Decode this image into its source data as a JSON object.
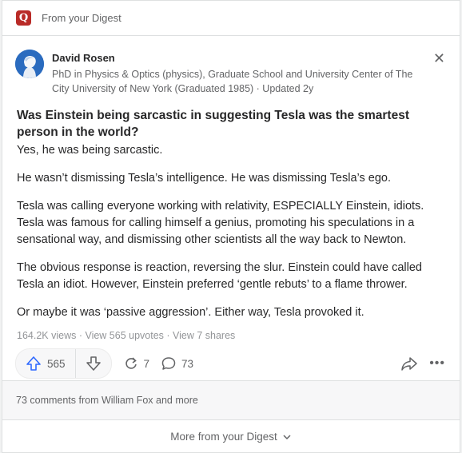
{
  "topbar": {
    "source": "From your Digest"
  },
  "author": {
    "name": "David Rosen",
    "credential": "PhD in Physics & Optics (physics), Graduate School and University Center of The City University of New York (Graduated 1985) · Updated 2y"
  },
  "question": "Was Einstein being sarcastic in suggesting Tesla was the smartest person in the world?",
  "answer": [
    "Yes, he was being sarcastic.",
    "He wasn’t dismissing Tesla’s intelligence. He was dismissing Tesla’s ego.",
    "Tesla was calling everyone working with relativity, ESPECIALLY Einstein, idiots. Tesla was famous for calling himself a genius, promoting his speculations in a sensational way, and dismissing other scientists all the way back to Newton.",
    "The obvious response is reaction, reversing the slur. Einstein could have called Tesla an idiot. However, Einstein preferred ‘gentle rebuts’ to a flame thrower.",
    "Or maybe it was ‘passive aggression’. Either way, Tesla provoked it."
  ],
  "stats": "164.2K views · View 565 upvotes · View 7 shares",
  "actions": {
    "upvotes": "565",
    "shares": "7",
    "comments": "73"
  },
  "comments_line": "73 comments from William Fox and more",
  "more_from": "More from your Digest",
  "colors": {
    "brand": "#b92b27",
    "upvote": "#2e69ff"
  }
}
